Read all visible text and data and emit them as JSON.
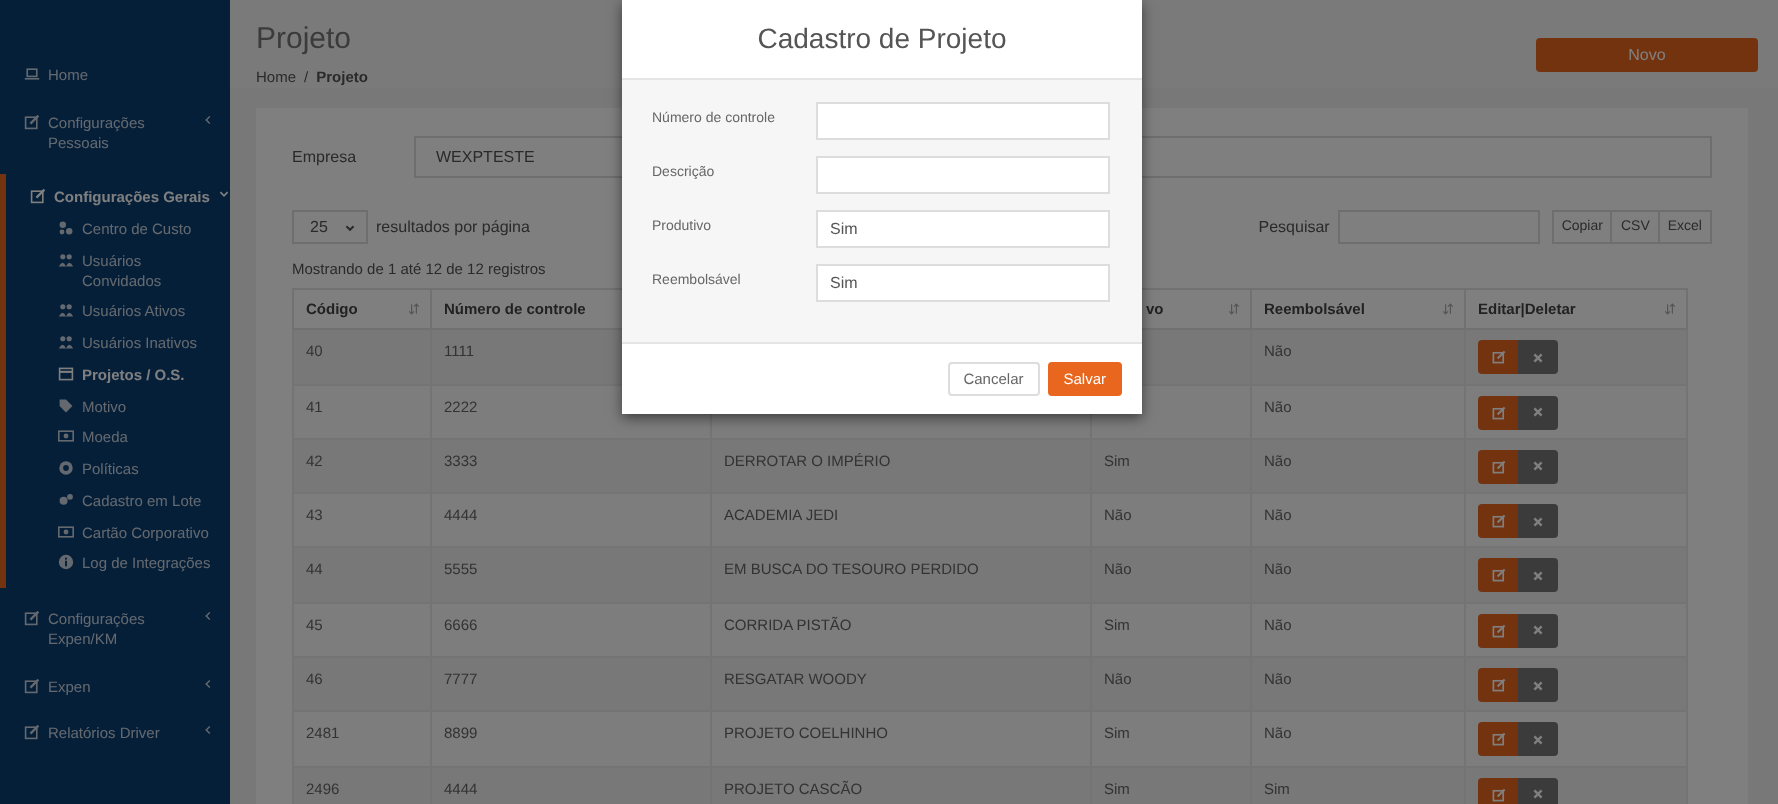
{
  "sidebar": {
    "items": [
      {
        "label": "Home"
      },
      {
        "label": "Configurações Pessoais",
        "expanded": false
      },
      {
        "label": "Configurações Gerais",
        "expanded": true,
        "children": [
          {
            "label": "Centro de Custo",
            "selected": false
          },
          {
            "label": "Usuários Convidados",
            "selected": false
          },
          {
            "label": "Usuários Ativos",
            "selected": false
          },
          {
            "label": "Usuários Inativos",
            "selected": false
          },
          {
            "label": "Projetos / O.S.",
            "selected": true
          },
          {
            "label": "Motivo",
            "selected": false
          },
          {
            "label": "Moeda",
            "selected": false
          },
          {
            "label": "Políticas",
            "selected": false
          },
          {
            "label": "Cadastro em Lote",
            "selected": false
          },
          {
            "label": "Cartão Corporativo",
            "selected": false
          },
          {
            "label": "Log de Integrações",
            "selected": false
          }
        ]
      },
      {
        "label": "Configurações Expen/KM",
        "expanded": false
      },
      {
        "label": "Expen",
        "expanded": false
      },
      {
        "label": "Relatórios Driver",
        "expanded": false
      }
    ]
  },
  "page": {
    "title": "Projeto",
    "breadcrumb": [
      {
        "label": "Home",
        "kind": "link"
      },
      {
        "label": "/",
        "kind": "separator"
      },
      {
        "label": "Projeto",
        "kind": "current"
      }
    ],
    "new_button": "Novo"
  },
  "filter": {
    "label": "Empresa",
    "value": "WEXPTESTE"
  },
  "table_controls": {
    "page_size": "25",
    "page_size_label": "resultados por página",
    "search_label": "Pesquisar",
    "buttons": [
      "Copiar",
      "CSV",
      "Excel"
    ],
    "info": "Mostrando de 1 até 12 de 12 registros"
  },
  "table": {
    "columns": [
      "Código",
      "Número de controle",
      null,
      "vo",
      "Reembolsável",
      "Editar|Deletar"
    ],
    "rows": [
      {
        "cells": [
          "40",
          "1111",
          null,
          null,
          "Não"
        ]
      },
      {
        "cells": [
          "41",
          "2222",
          null,
          null,
          "Não"
        ]
      },
      {
        "cells": [
          "42",
          "3333",
          "DERROTAR O IMPÉRIO",
          "Sim",
          "Não"
        ]
      },
      {
        "cells": [
          "43",
          "4444",
          "ACADEMIA JEDI",
          "Não",
          "Não"
        ]
      },
      {
        "cells": [
          "44",
          "5555",
          "EM BUSCA DO TESOURO PERDIDO",
          "Não",
          "Não"
        ]
      },
      {
        "cells": [
          "45",
          "6666",
          "CORRIDA PISTÃO",
          "Sim",
          "Não"
        ]
      },
      {
        "cells": [
          "46",
          "7777",
          "RESGATAR WOODY",
          "Não",
          "Não"
        ]
      },
      {
        "cells": [
          "2481",
          "8899",
          "PROJETO COELHINHO",
          "Sim",
          "Não"
        ]
      },
      {
        "cells": [
          "2496",
          "4444",
          "PROJETO CASCÃO",
          "Sim",
          "Sim"
        ]
      }
    ]
  },
  "modal": {
    "title": "Cadastro de Projeto",
    "fields": [
      {
        "label": "Número de controle"
      },
      {
        "label": "Descrição"
      },
      {
        "label": "Produtivo",
        "value": "Sim"
      },
      {
        "label": "Reembolsável",
        "value": "Sim"
      }
    ],
    "buttons": [
      {
        "label": "Cancelar",
        "kind": "secondary"
      },
      {
        "label": "Salvar",
        "kind": "primary"
      }
    ]
  }
}
